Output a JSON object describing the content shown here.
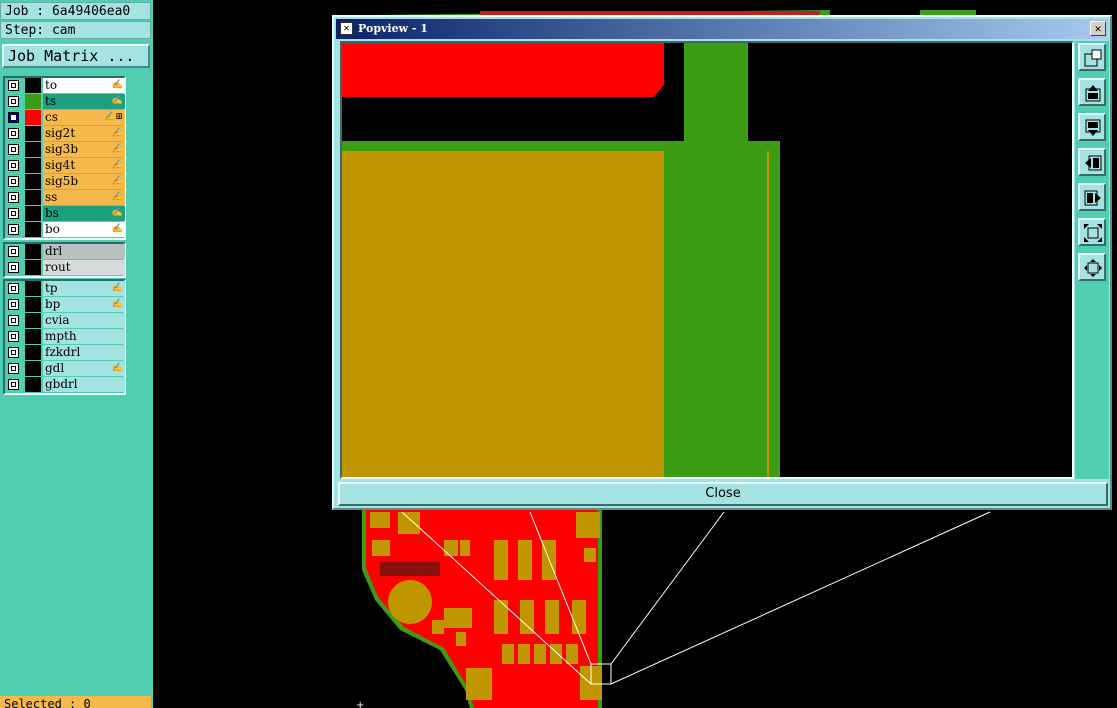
{
  "left_panel": {
    "job_line": "Job : 6a49406ea0",
    "step_line": "Step: cam",
    "matrix_button": "Job Matrix ...",
    "selected_line": "Selected : 0",
    "layer_groups": [
      [
        {
          "name": "to",
          "swatch": "#000000",
          "bg": "#ffffff",
          "flag": "✍",
          "checked": false
        },
        {
          "name": "ts",
          "swatch": "#3c9c14",
          "bg": "#1ea080",
          "flag": "✍",
          "checked": false
        },
        {
          "name": "cs",
          "swatch": "#ff0000",
          "bg": "#f5b84a",
          "flag": "✍⊞",
          "checked": true
        },
        {
          "name": "sig2t",
          "swatch": "#000000",
          "bg": "#f5b84a",
          "flag": "✍",
          "checked": false
        },
        {
          "name": "sig3b",
          "swatch": "#000000",
          "bg": "#f5b84a",
          "flag": "✍",
          "checked": false
        },
        {
          "name": "sig4t",
          "swatch": "#000000",
          "bg": "#f5b84a",
          "flag": "✍",
          "checked": false
        },
        {
          "name": "sig5b",
          "swatch": "#000000",
          "bg": "#f5b84a",
          "flag": "✍",
          "checked": false
        },
        {
          "name": "ss",
          "swatch": "#000000",
          "bg": "#f5b84a",
          "flag": "✍",
          "checked": false
        },
        {
          "name": "bs",
          "swatch": "#000000",
          "bg": "#1ea080",
          "flag": "✍",
          "checked": false
        },
        {
          "name": "bo",
          "swatch": "#000000",
          "bg": "#ffffff",
          "flag": "✍",
          "checked": false
        }
      ],
      [
        {
          "name": "drl",
          "swatch": "#000000",
          "bg": "#b8c0c0",
          "flag": "",
          "checked": false
        },
        {
          "name": "rout",
          "swatch": "#000000",
          "bg": "#d8dcdc",
          "flag": "",
          "checked": false
        }
      ],
      [
        {
          "name": "tp",
          "swatch": "#000000",
          "bg": "#a5e2e2",
          "flag": "✍",
          "checked": false
        },
        {
          "name": "bp",
          "swatch": "#000000",
          "bg": "#a5e2e2",
          "flag": "✍",
          "checked": false
        },
        {
          "name": "cvia",
          "swatch": "#000000",
          "bg": "#a5e2e2",
          "flag": "",
          "checked": false
        },
        {
          "name": "mpth",
          "swatch": "#000000",
          "bg": "#a5e2e2",
          "flag": "",
          "checked": false
        },
        {
          "name": "fzkdrl",
          "swatch": "#000000",
          "bg": "#a5e2e2",
          "flag": "",
          "checked": false
        },
        {
          "name": "gdl",
          "swatch": "#000000",
          "bg": "#a5e2e2",
          "flag": "✍",
          "checked": false
        },
        {
          "name": "gbdrl",
          "swatch": "#000000",
          "bg": "#a5e2e2",
          "flag": "",
          "checked": false
        }
      ]
    ]
  },
  "popup": {
    "title": "Popview - 1",
    "close_button": "Close",
    "tools": [
      {
        "name": "toggle-window-icon"
      },
      {
        "name": "pan-up-icon"
      },
      {
        "name": "pan-down-icon"
      },
      {
        "name": "pan-left-icon"
      },
      {
        "name": "pan-right-icon"
      },
      {
        "name": "zoom-fit-icon"
      },
      {
        "name": "zoom-home-icon"
      }
    ]
  },
  "colors": {
    "copper": "#ff0000",
    "pad": "#c09600",
    "mask": "#3c9c14",
    "panel": "#4fcfaf",
    "light_panel": "#a5e2e2"
  }
}
